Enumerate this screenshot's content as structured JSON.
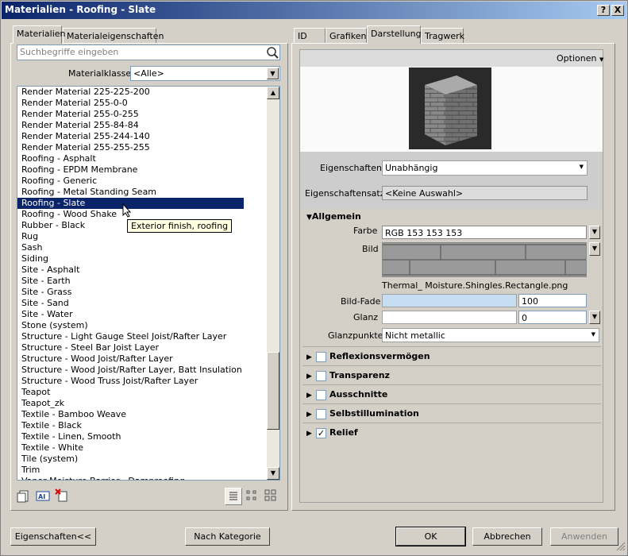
{
  "window": {
    "title": "Materialien - Roofing - Slate",
    "help_label": "?",
    "close_label": "X"
  },
  "left_tabs": [
    "Materialien",
    "Materialeigenschaften"
  ],
  "search": {
    "placeholder": "Suchbegriffe eingeben"
  },
  "class_filter": {
    "label": "Materialklasse:",
    "value": "<Alle>"
  },
  "materials": [
    "Render Material 225-225-200",
    "Render Material 255-0-0",
    "Render Material 255-0-255",
    "Render Material 255-84-84",
    "Render Material 255-244-140",
    "Render Material 255-255-255",
    "Roofing - Asphalt",
    "Roofing - EPDM Membrane",
    "Roofing - Generic",
    "Roofing - Metal Standing Seam",
    "Roofing - Slate",
    "Roofing - Wood Shake",
    "Rubber - Black",
    "Rug",
    "Sash",
    "Siding",
    "Site - Asphalt",
    "Site - Earth",
    "Site - Grass",
    "Site - Sand",
    "Site - Water",
    "Stone (system)",
    "Structure - Light Gauge Steel Joist/Rafter Layer",
    "Structure - Steel Bar Joist Layer",
    "Structure - Wood Joist/Rafter Layer",
    "Structure - Wood Joist/Rafter Layer, Batt Insulation",
    "Structure - Wood Truss Joist/Rafter Layer",
    "Teapot",
    "Teapot_zk",
    "Textile - Bamboo Weave",
    "Textile - Black",
    "Textile - Linen, Smooth",
    "Textile - White",
    "Tile (system)",
    "Trim",
    "Vapor Moisture Barrier - Damproofing"
  ],
  "selected_index": 10,
  "tooltip": "Exterior finish, roofing",
  "right_tabs": [
    "ID",
    "Grafiken",
    "Darstellung",
    "Tragwerk"
  ],
  "options_label": "Optionen",
  "props": {
    "label": "Eigenschaften",
    "value": "Unabhängig"
  },
  "propset": {
    "label": "Eigenschaftensatz",
    "value": "<Keine Auswahl>"
  },
  "general": {
    "title": "Allgemein",
    "color_label": "Farbe",
    "color_value": "RGB 153 153 153",
    "image_label": "Bild",
    "image_file": "Thermal_ Moisture.Shingles.Rectangle.png",
    "fade_label": "Bild-Fade",
    "fade_value": "100",
    "fade_fraction": 1.0,
    "gloss_label": "Glanz",
    "gloss_value": "0",
    "highlights_label": "Glanzpunkte",
    "highlights_value": "Nicht metallic"
  },
  "sections": [
    {
      "label": "Reflexionsvermögen",
      "checked": false
    },
    {
      "label": "Transparenz",
      "checked": false
    },
    {
      "label": "Ausschnitte",
      "checked": false
    },
    {
      "label": "Selbstillumination",
      "checked": false
    },
    {
      "label": "Relief",
      "checked": true
    }
  ],
  "buttons": {
    "props": "Eigenschaften<<",
    "category": "Nach Kategorie",
    "ok": "OK",
    "cancel": "Abbrechen",
    "apply": "Anwenden"
  },
  "colors": {
    "selection": "#0a246a",
    "swatch": "#999999",
    "fade_fill": "#c7ddf2"
  }
}
